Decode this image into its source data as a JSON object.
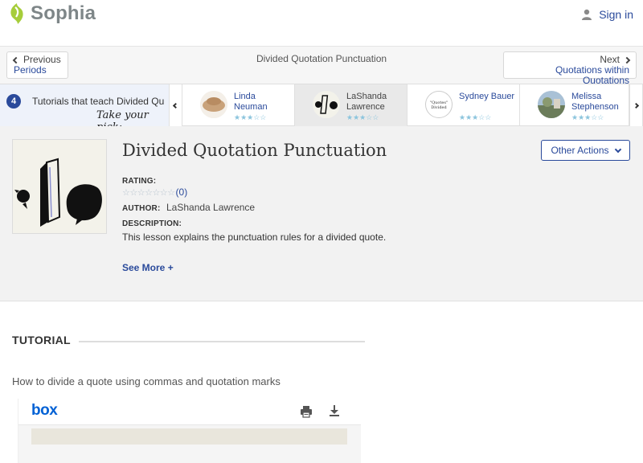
{
  "header": {
    "brand": "Sophia",
    "brand_color": "#a6cd3a",
    "sign_in": "Sign in"
  },
  "nav": {
    "prev_top": "Previous",
    "prev_bottom": "Periods",
    "title": "Divided Quotation Punctuation",
    "next_top": "Next",
    "next_bottom": "Quotations within Quotations"
  },
  "strip": {
    "count": "4",
    "title": "Tutorials that teach Divided Qu",
    "take_pick": "Take your pick:",
    "cards": [
      {
        "name": "Linda Neuman",
        "stars": "★★★☆☆"
      },
      {
        "name": "LaShanda Lawrence",
        "stars": "★★★☆☆"
      },
      {
        "name": "Sydney Bauer",
        "stars": "★★★☆☆",
        "thumb_text": "\"Quotes\" Divided"
      },
      {
        "name": "Melissa Stephenson",
        "stars": "★★★☆☆"
      }
    ]
  },
  "detail": {
    "title": "Divided Quotation Punctuation",
    "other_actions": "Other Actions",
    "rating_label": "RATING:",
    "rating_stars": "☆☆☆☆☆☆☆",
    "rating_count": "(0)",
    "author_label": "AUTHOR:",
    "author": "LaShanda Lawrence",
    "description_label": "DESCRIPTION:",
    "description": "This lesson explains the punctuation rules for a divided quote.",
    "see_more": "See More +"
  },
  "tutorial": {
    "heading": "TUTORIAL",
    "subtitle": "How to divide a quote using commas and quotation marks",
    "viewer_logo": "box"
  },
  "colors": {
    "link": "#2a4a9b",
    "box_blue": "#0061d5"
  }
}
